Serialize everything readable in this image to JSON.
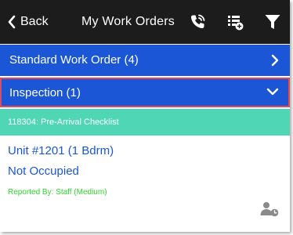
{
  "navbar": {
    "back_label": "Back",
    "title": "My Work Orders",
    "background": "#1c1c1c",
    "icons": [
      "chevron-left-icon",
      "phone-call-icon",
      "list-add-icon",
      "filter-icon"
    ]
  },
  "groups": [
    {
      "label": "Standard Work Order (4)",
      "state": "collapsed",
      "chevron": "chevron-right-icon"
    },
    {
      "label": "Inspection (1)",
      "state": "expanded",
      "chevron": "chevron-down-icon"
    }
  ],
  "checklist": {
    "label": "118304:  Pre-Arrival Checklist",
    "color": "#4fd7b5"
  },
  "work_order": {
    "unit": "Unit #1201 (1 Bdrm)",
    "occupancy": "Not Occupied",
    "reported": "Reported By: Staff  (Medium)",
    "action_icon": "assign-user-icon"
  },
  "colors": {
    "group_blue": "#1a56d6",
    "highlight_border": "#e34a55",
    "link_blue": "#1a56d6",
    "reported_green": "#2fd22f"
  }
}
